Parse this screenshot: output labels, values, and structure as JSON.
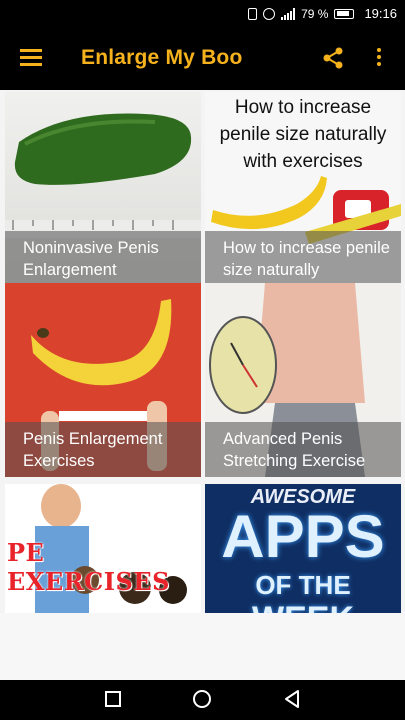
{
  "status": {
    "battery_pct": "79 %",
    "time": "19:16"
  },
  "app_bar": {
    "title": "Enlarge My Boo"
  },
  "cards": [
    {
      "caption": "Noninvasive Penis Enlargement"
    },
    {
      "caption": "How to increase penile size naturally",
      "image_text": "How to increase penile size naturally with exercises"
    },
    {
      "caption": "Penis Enlargement Exercises"
    },
    {
      "caption": "Advanced Penis Stretching Exercise"
    },
    {
      "image_text": "PE EXERCISES"
    },
    {
      "image_text_top": "AWESOME",
      "image_text_mid": "APPS",
      "image_text_bottom": "OF THE",
      "image_text_cut": "WEEK"
    }
  ],
  "colors": {
    "accent": "#f5b21d",
    "bar": "#000000"
  }
}
